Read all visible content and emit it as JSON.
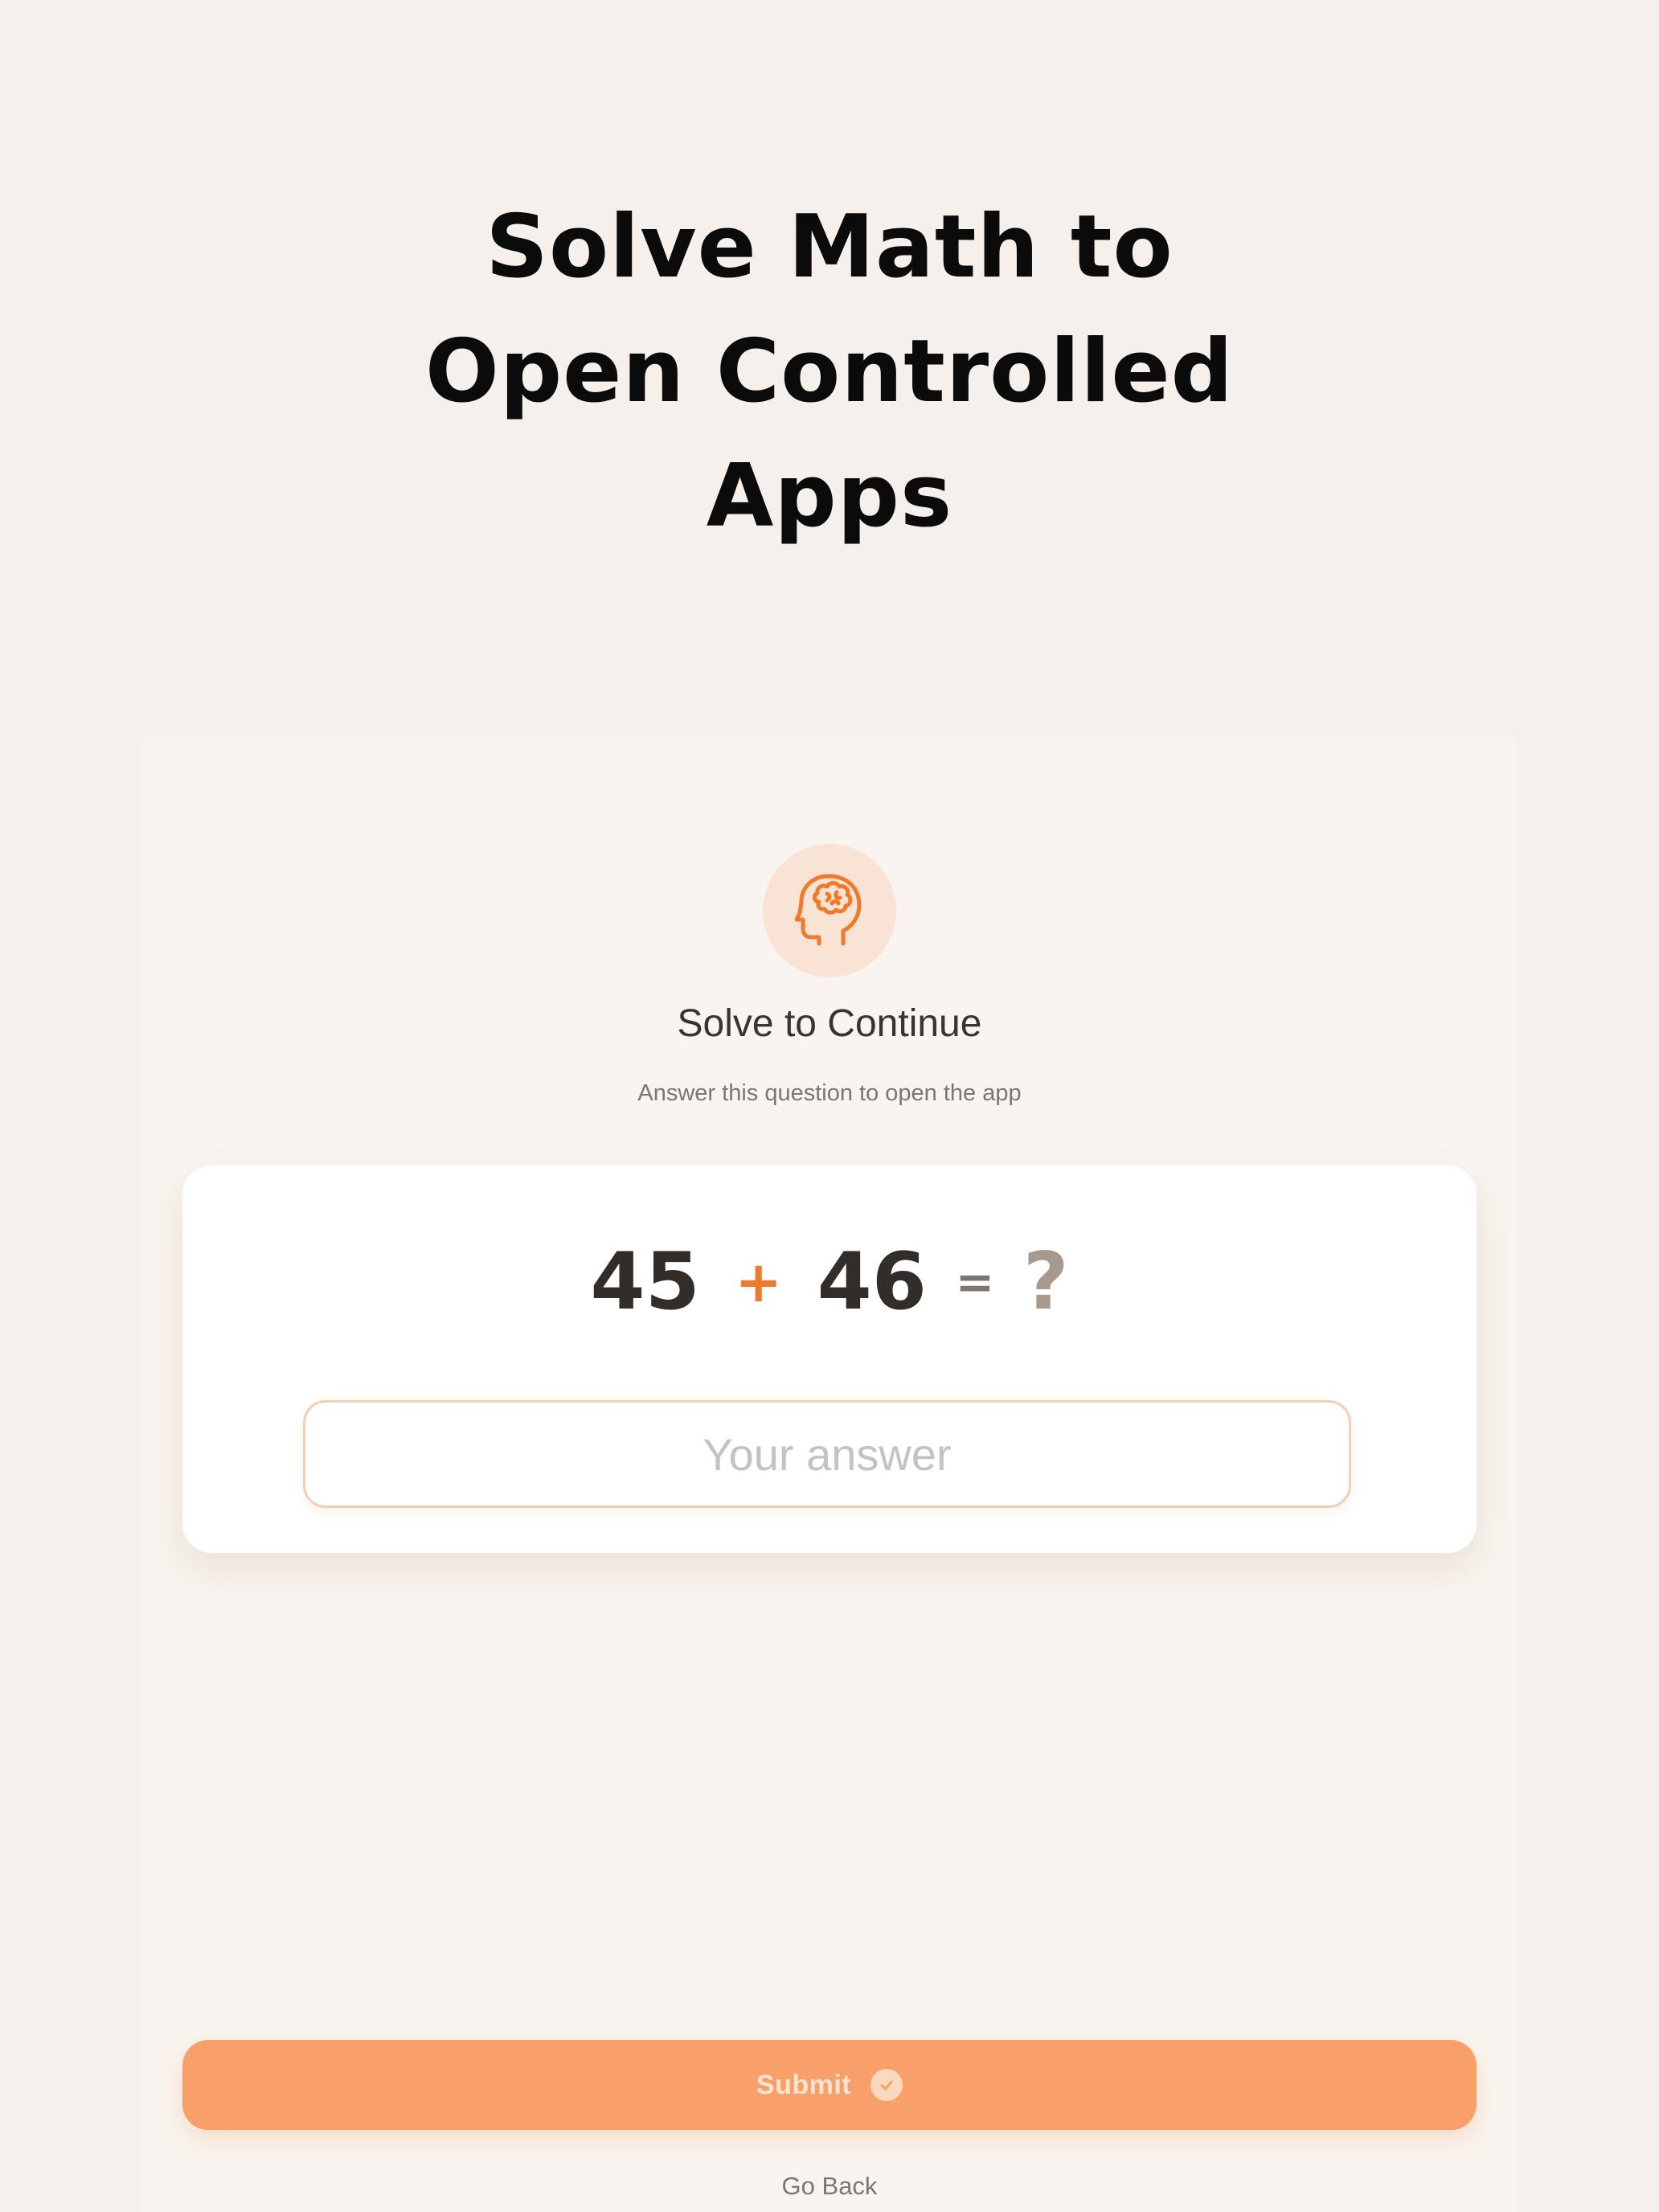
{
  "headline": {
    "line1": "Solve Math to",
    "line2": "Open Controlled",
    "line3": "Apps"
  },
  "sheet": {
    "icon": "brain-head-icon",
    "title": "Solve to Continue",
    "subtitle": "Answer this question to open the app"
  },
  "question": {
    "operand1": "45",
    "operator": "+",
    "operand2": "46",
    "equals": "=",
    "unknown": "?"
  },
  "answer": {
    "value": "",
    "placeholder": "Your answer"
  },
  "actions": {
    "submit_label": "Submit",
    "submit_icon": "check-circle-icon",
    "go_back_label": "Go Back"
  },
  "colors": {
    "background": "#f5f0eb",
    "sheet": "#f9f4ef",
    "accent": "#f07a2c",
    "submit": "#f9a06a",
    "input_border": "#f5cdb0"
  }
}
